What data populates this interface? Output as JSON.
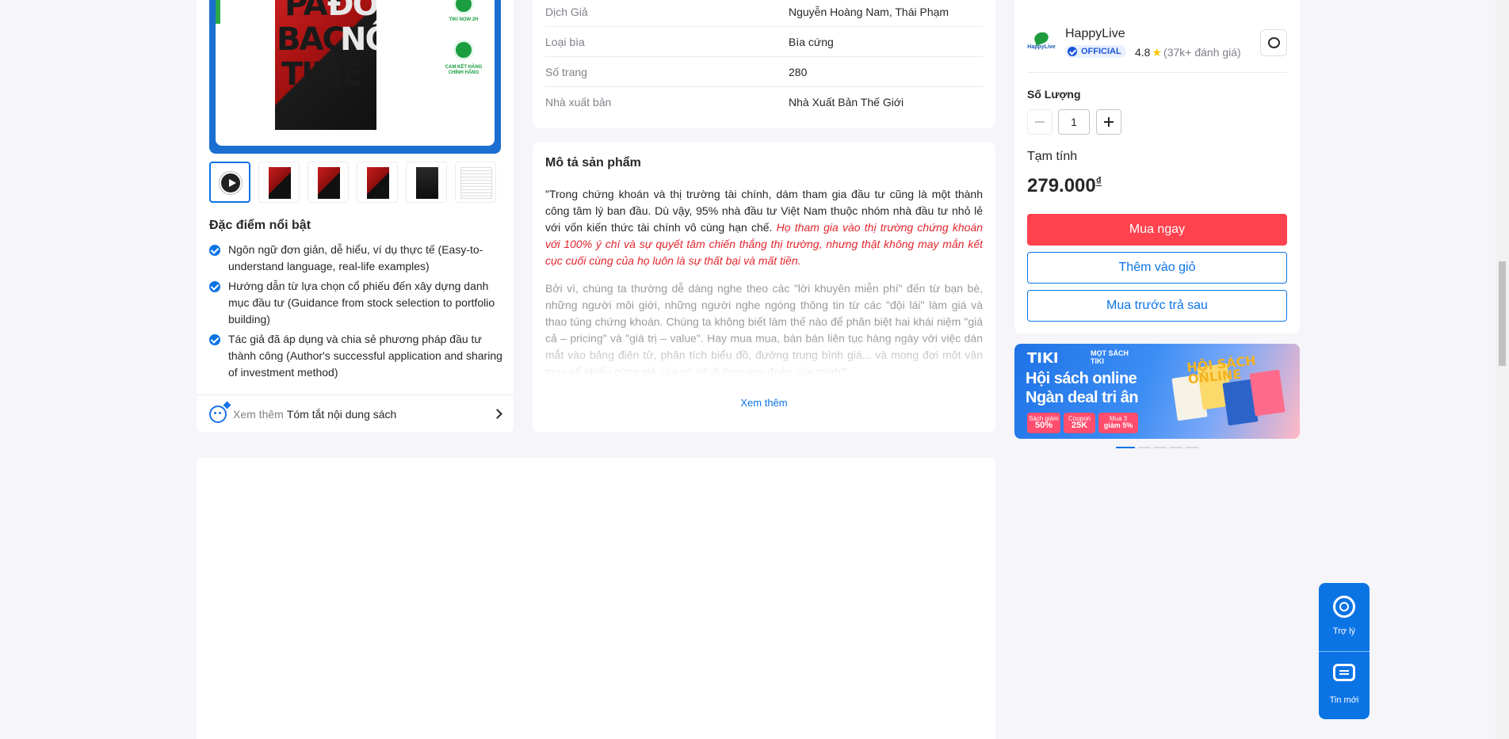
{
  "highlights": {
    "title": "Đặc điểm nổi bật",
    "items": [
      "Ngôn ngữ đơn giản, dễ hiểu, ví dụ thực tế (Easy-to-understand language, real-life examples)",
      "Hướng dẫn từ lựa chọn cổ phiếu đến xây dựng danh mục đầu tư (Guidance from stock selection to portfolio building)",
      "Tác giả đã áp dụng và chia sẻ phương pháp đầu tư thành công (Author's successful application and sharing of investment method)"
    ]
  },
  "summary_link": {
    "prefix": "Xem thêm",
    "text": "Tóm tắt nội dung sách"
  },
  "book_cover": {
    "line1": "PAY",
    "line1b": "ĐỜI",
    "line2": "BACK",
    "line2b": "NỔ",
    "line3": "TIME"
  },
  "main_image_badges": {
    "badge1": "TIKI NOW 2H",
    "badge2": "CAM KẾT HÀNG CHÍNH HÃNG"
  },
  "specs": [
    {
      "key": "Dịch Giả",
      "value": "Nguyễn Hoàng Nam, Thái Phạm"
    },
    {
      "key": "Loại bìa",
      "value": "Bìa cứng"
    },
    {
      "key": "Số trang",
      "value": "280"
    },
    {
      "key": "Nhà xuất bản",
      "value": "Nhà Xuất Bản Thế Giới"
    }
  ],
  "description": {
    "title": "Mô tả sản phẩm",
    "p1_normal": "\"Trong chứng khoán và thị trường tài chính, dám tham gia đầu tư cũng là một thành công tâm lý ban đầu. Dù vậy, 95% nhà đầu tư Việt Nam thuộc nhóm nhà đầu tư nhỏ lẻ với vốn kiến thức tài chính vô cùng hạn chế.",
    "p1_red": "Họ tham gia vào thị trường chứng khoán với 100% ý chí và sự quyết tâm chiến thắng thị trường, nhưng thật không may mắn kết cục cuối cùng của họ luôn là sự thất bại và mất tiền.",
    "p2": "Bởi vì, chúng ta thường dễ dàng nghe theo các \"lời khuyên miễn phí\" đến từ bạn bè, những người môi giới, những người nghe ngóng thông tin từ các \"đội lái\" làm giá và thao túng chứng khoán. Chúng ta không biết làm thế nào để phân biệt hai khái niệm \"giá cả – pricing\" và \"giá trị – value\". Hay mua mua, bán bán liên tục hàng ngày với việc dán mắt vào bảng điện tử, phân tích biểu đồ, đường trung bình giá... và mong đợi một vận may cổ phiếu cùng giá của nó sẽ đi theo suy đoán của mình?",
    "see_more": "Xem thêm"
  },
  "seller": {
    "name": "HappyLive",
    "logo_text": "HappyLive",
    "official": "OFFICIAL",
    "rating": "4.8",
    "review_count": "(37k+ đánh giá)"
  },
  "quantity": {
    "label": "Số Lượng",
    "value": "1"
  },
  "subtotal": {
    "label": "Tạm tính",
    "price": "279.000",
    "currency": "₫"
  },
  "buttons": {
    "buy_now": "Mua ngay",
    "add_to_cart": "Thêm vào giỏ",
    "buy_later": "Mua trước trả sau"
  },
  "banner": {
    "logo": "TIKI",
    "tag": "MỌT SÁCH TIKI",
    "line1": "Hội sách online",
    "line2": "Ngàn deal tri ân",
    "promo1_top": "Sách giảm",
    "promo1_val": "50%",
    "promo2_top": "Coupon",
    "promo2_val": "25K",
    "promo3_top": "Mua 3",
    "promo3_val": "giảm 5%",
    "online_word1": "HỘI",
    "online_word2": "SÁCH",
    "online_word3": "ONLINE"
  },
  "float_panel": {
    "assist": "Trợ lý",
    "messages": "Tin mới"
  },
  "colors": {
    "accent": "#0b74e5",
    "buy": "#ff424e",
    "highlight_red": "#e0262e",
    "official": "#1a56db"
  }
}
